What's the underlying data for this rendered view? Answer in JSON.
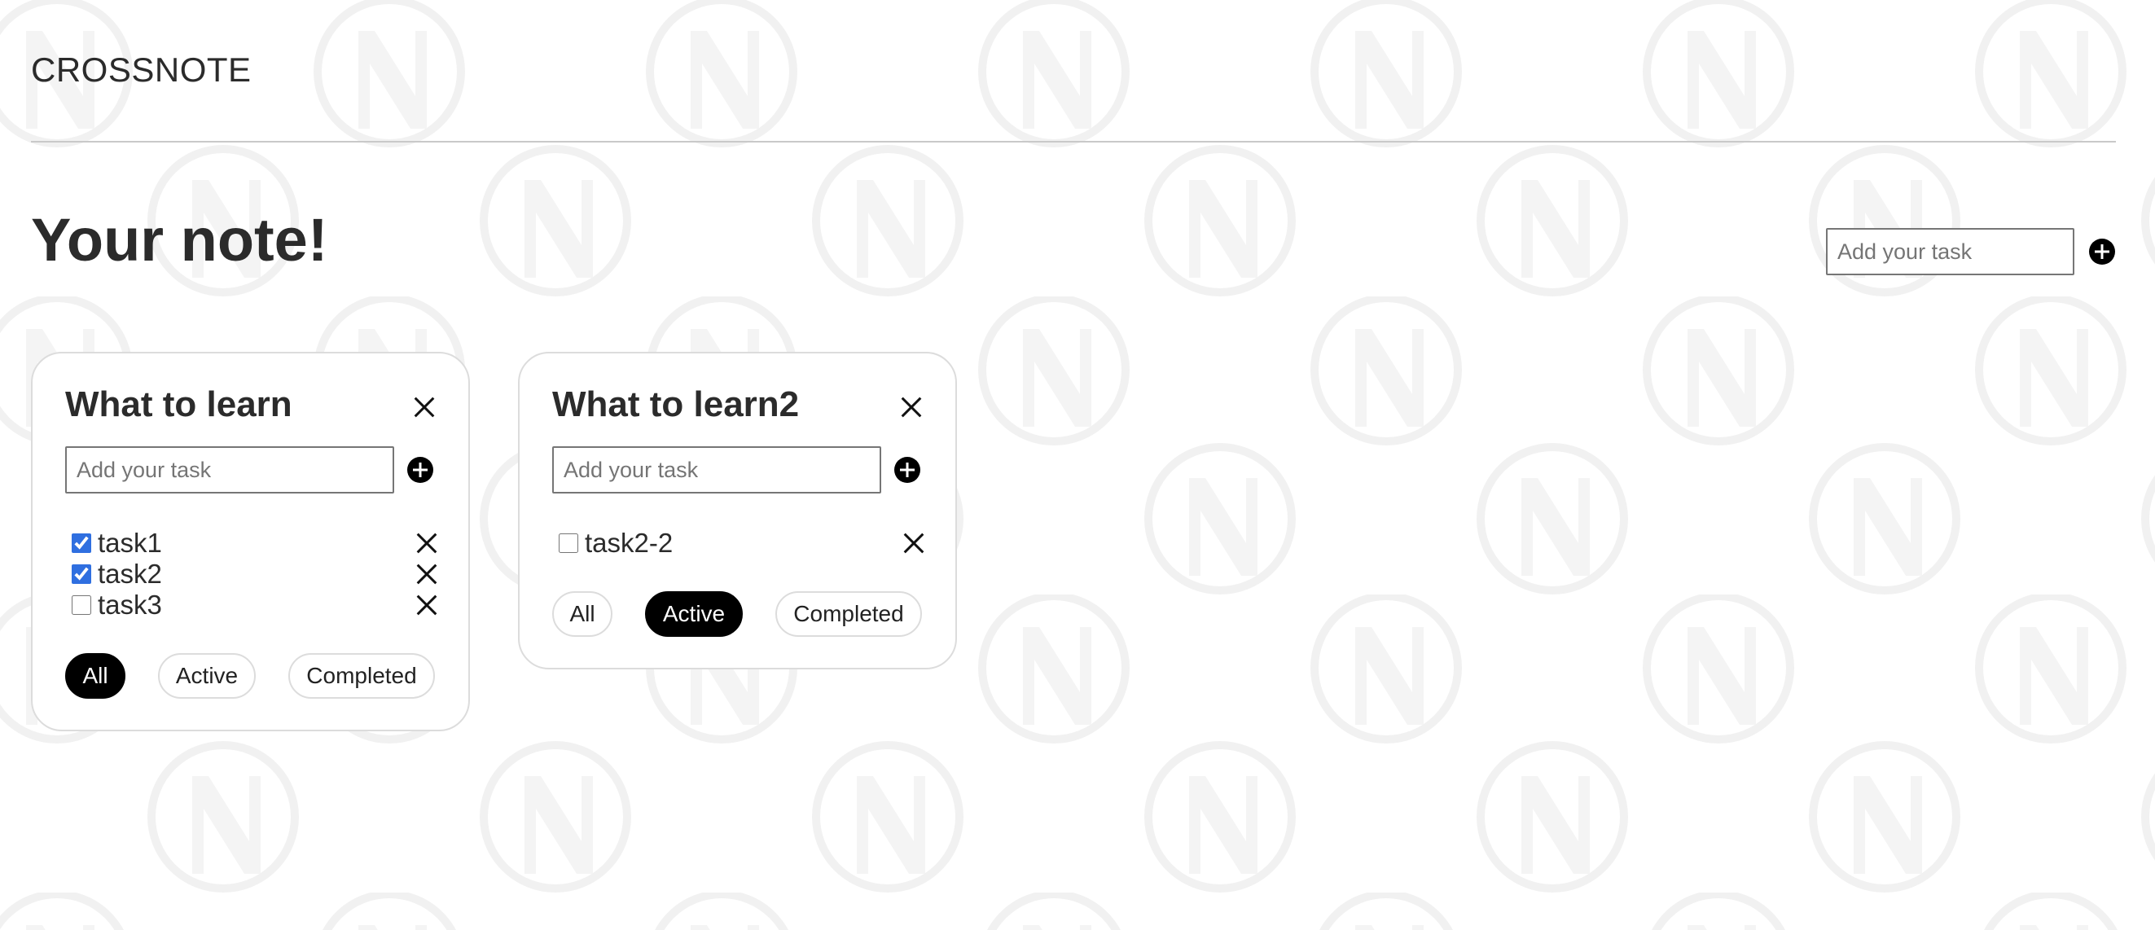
{
  "app": {
    "brand": "CROSSNOTE",
    "page_title": "Your note!"
  },
  "global_add": {
    "placeholder": "Add your task",
    "value": ""
  },
  "colors": {
    "accent": "#000000",
    "checkbox": "#2f6fe0",
    "card_border": "#dcdcdc",
    "background_pattern": "#f2f2f2"
  },
  "cards": [
    {
      "title": "What to learn",
      "input_placeholder": "Add your task",
      "tasks": [
        {
          "label": "task1",
          "checked": true
        },
        {
          "label": "task2",
          "checked": true
        },
        {
          "label": "task3",
          "checked": false
        }
      ],
      "filters": [
        {
          "label": "All",
          "selected": true
        },
        {
          "label": "Active",
          "selected": false
        },
        {
          "label": "Completed",
          "selected": false
        }
      ]
    },
    {
      "title": "What to learn2",
      "input_placeholder": "Add your task",
      "tasks": [
        {
          "label": "task2-2",
          "checked": false
        }
      ],
      "filters": [
        {
          "label": "All",
          "selected": false
        },
        {
          "label": "Active",
          "selected": true
        },
        {
          "label": "Completed",
          "selected": false
        }
      ]
    }
  ],
  "icons": {
    "add": "plus-circle-icon",
    "remove": "close-icon",
    "background": "n-logo-pattern"
  }
}
